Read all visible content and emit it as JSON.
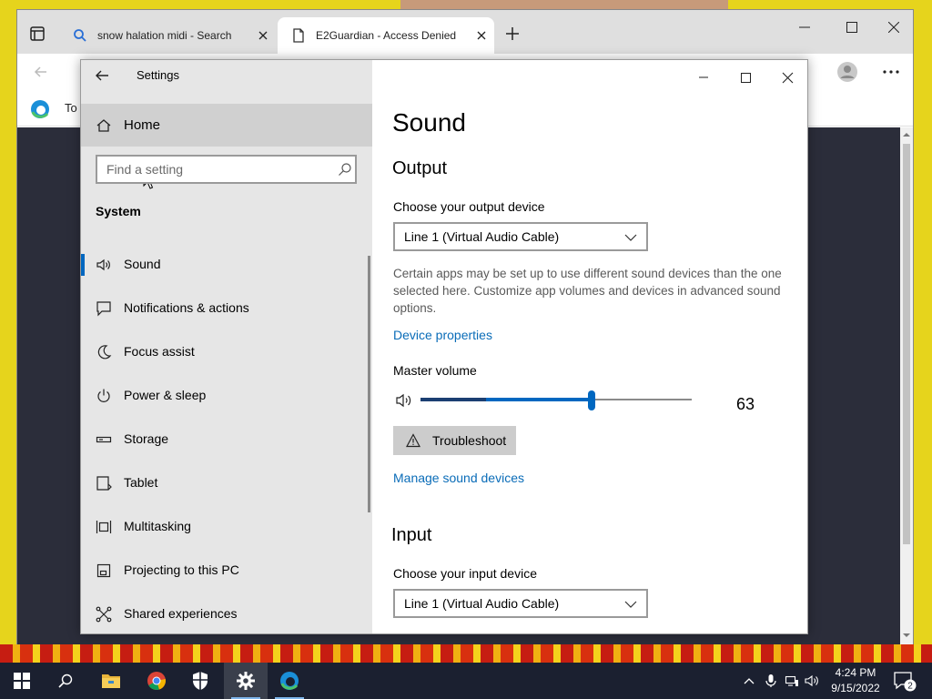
{
  "browser": {
    "tabs": [
      {
        "title": "snow halation midi - Search",
        "icon": "search-icon"
      },
      {
        "title": "E2Guardian - Access Denied",
        "icon": "page-icon"
      }
    ],
    "favorites_bar_text": "To"
  },
  "settings": {
    "window_title": "Settings",
    "home_label": "Home",
    "search_placeholder": "Find a setting",
    "category_heading": "System",
    "nav_items": [
      {
        "label": "Sound",
        "icon": "speaker-icon",
        "active": true
      },
      {
        "label": "Notifications & actions",
        "icon": "notification-icon"
      },
      {
        "label": "Focus assist",
        "icon": "moon-icon"
      },
      {
        "label": "Power & sleep",
        "icon": "power-icon"
      },
      {
        "label": "Storage",
        "icon": "storage-icon"
      },
      {
        "label": "Tablet",
        "icon": "tablet-icon"
      },
      {
        "label": "Multitasking",
        "icon": "multitasking-icon"
      },
      {
        "label": "Projecting to this PC",
        "icon": "projecting-icon"
      },
      {
        "label": "Shared experiences",
        "icon": "shared-experiences-icon"
      }
    ],
    "page_title": "Sound",
    "output": {
      "heading": "Output",
      "device_label": "Choose your output device",
      "device_value": "Line 1 (Virtual Audio Cable)",
      "description": "Certain apps may be set up to use different sound devices than the one selected here. Customize app volumes and devices in advanced sound options.",
      "device_properties_link": "Device properties",
      "master_volume_label": "Master volume",
      "volume": 63,
      "troubleshoot_label": "Troubleshoot",
      "manage_devices_link": "Manage sound devices"
    },
    "input": {
      "heading": "Input",
      "device_label": "Choose your input device",
      "device_value": "Line 1 (Virtual Audio Cable)"
    }
  },
  "taskbar": {
    "apps": [
      "start-icon",
      "search-icon",
      "file-explorer-icon",
      "chrome-icon",
      "security-icon",
      "settings-icon",
      "edge-icon"
    ],
    "time": "4:24 PM",
    "date": "9/15/2022",
    "notification_count": "2"
  },
  "colors": {
    "accent": "#0067c0",
    "link": "#0a6cb8",
    "nav_background": "#e6e6e6",
    "taskbar": "#1b2030"
  }
}
